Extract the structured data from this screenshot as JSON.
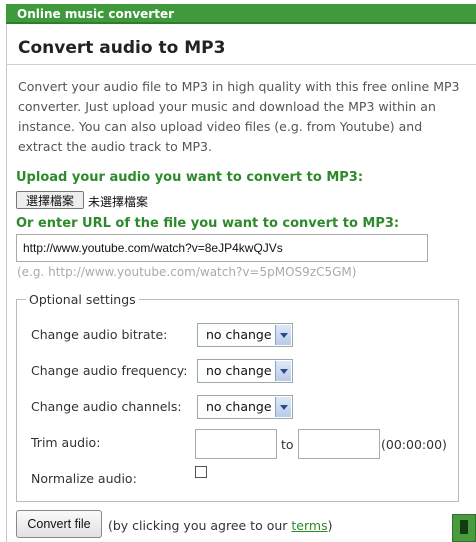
{
  "header": {
    "app_title": "Online music converter"
  },
  "main": {
    "title": "Convert audio to MP3",
    "intro": "Convert your audio file to MP3 in high quality with this free online MP3 converter. Just upload your music and download the MP3 within an instance. You can also upload video files (e.g. from Youtube) and extract the audio track to MP3.",
    "upload_heading": "Upload your audio you want to convert to MP3:",
    "file_button": "選擇檔案",
    "file_status": "未選擇檔案",
    "url_heading": "Or enter URL of the file you want to convert to MP3:",
    "url_value": "http://www.youtube.com/watch?v=8eJP4kwQJVs",
    "url_hint": "(e.g. http://www.youtube.com/watch?v=5pMOS9zC5GM)"
  },
  "options": {
    "legend": "Optional settings",
    "bitrate_label": "Change audio bitrate:",
    "bitrate_value": "no change",
    "frequency_label": "Change audio frequency:",
    "frequency_value": "no change",
    "channels_label": "Change audio channels:",
    "channels_value": "no change",
    "trim_label": "Trim audio:",
    "trim_to": "to",
    "trim_format": "(00:00:00)",
    "normalize_label": "Normalize audio:",
    "normalize_checked": false
  },
  "footer": {
    "convert_button": "Convert file",
    "agree_prefix": "(by clicking you agree to our ",
    "terms_link": "terms",
    "agree_suffix": ")"
  }
}
